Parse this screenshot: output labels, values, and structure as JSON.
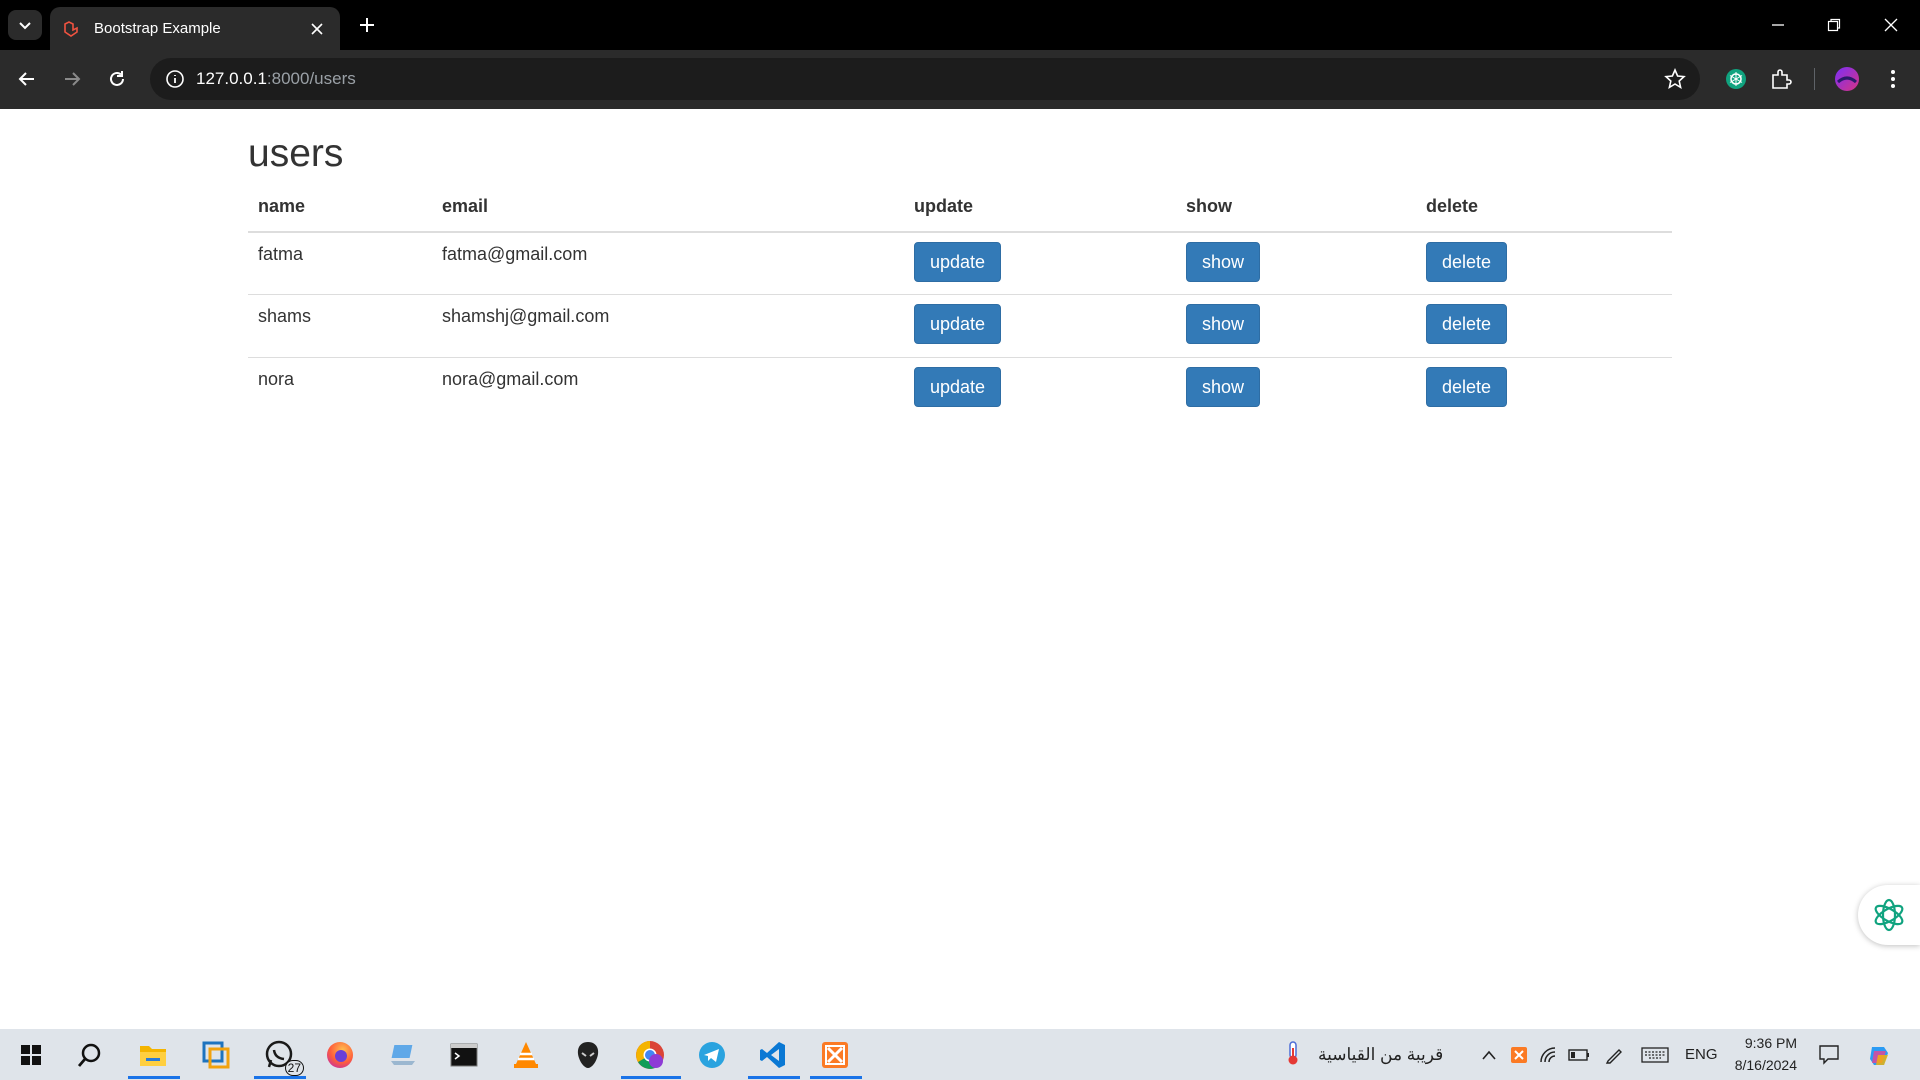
{
  "browser": {
    "tab_title": "Bootstrap Example",
    "url_host": "127.0.0.1",
    "url_rest": ":8000/users"
  },
  "page": {
    "heading": "users",
    "columns": [
      "name",
      "email",
      "update",
      "show",
      "delete"
    ],
    "rows": [
      {
        "name": "fatma",
        "email": "fatma@gmail.com",
        "update": "update",
        "show": "show",
        "delete": "delete"
      },
      {
        "name": "shams",
        "email": "shamshj@gmail.com",
        "update": "update",
        "show": "show",
        "delete": "delete"
      },
      {
        "name": "nora",
        "email": "nora@gmail.com",
        "update": "update",
        "show": "show",
        "delete": "delete"
      }
    ],
    "button_color": "#337ab7"
  },
  "taskbar": {
    "whatsapp_badge": "27",
    "weather_text": "قريبة من القياسية",
    "language": "ENG",
    "time": "9:36 PM",
    "date": "8/16/2024"
  }
}
